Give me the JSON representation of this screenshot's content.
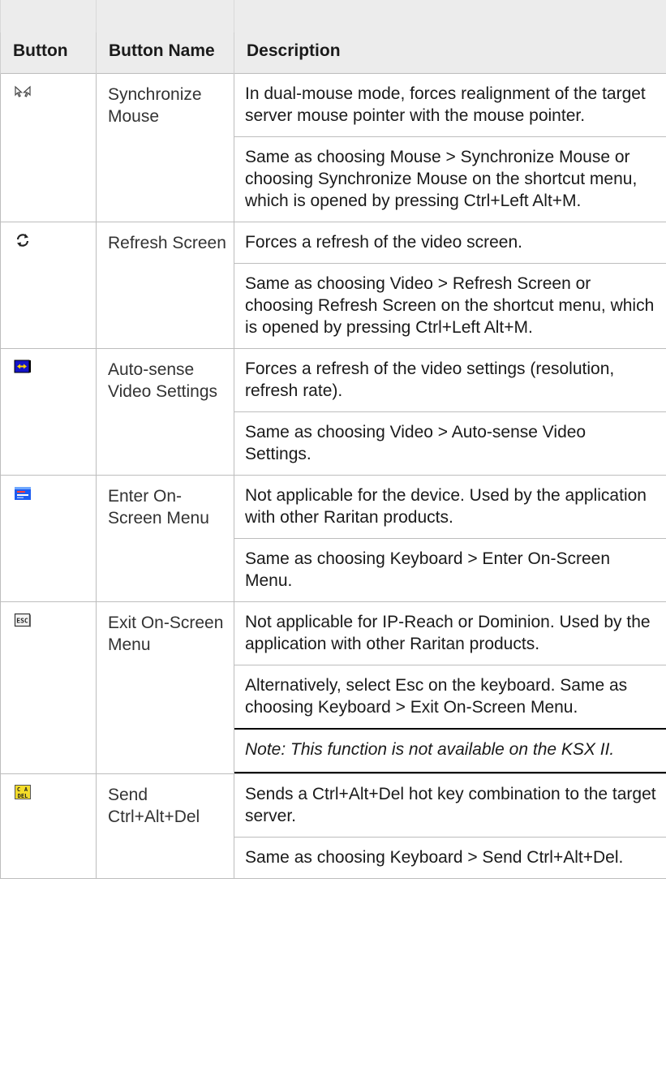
{
  "headers": {
    "button": "Button",
    "button_name": "Button Name",
    "description": "Description"
  },
  "rows": [
    {
      "icon": "synchronize-mouse-icon",
      "name": "Synchronize Mouse",
      "paragraphs": [
        "In dual-mouse mode, forces realignment of the target server mouse pointer with the mouse pointer.",
        "Same as choosing Mouse > Synchronize Mouse or choosing Synchronize Mouse on the shortcut menu, which is opened by pressing Ctrl+Left Alt+M."
      ]
    },
    {
      "icon": "refresh-screen-icon",
      "name": "Refresh Screen",
      "paragraphs": [
        "Forces a refresh of the video screen.",
        "Same as choosing Video > Refresh Screen or choosing Refresh Screen on the shortcut menu, which is opened by pressing Ctrl+Left Alt+M."
      ]
    },
    {
      "icon": "auto-sense-video-icon",
      "name": "Auto-sense Video Settings",
      "paragraphs": [
        "Forces a refresh of the video settings (resolution, refresh rate).",
        "Same as choosing Video > Auto-sense Video Settings."
      ]
    },
    {
      "icon": "enter-osd-menu-icon",
      "name": "Enter On-Screen Menu",
      "paragraphs": [
        "Not applicable for the device. Used by the application with other Raritan products.",
        "Same as choosing Keyboard > Enter On-Screen Menu."
      ]
    },
    {
      "icon": "exit-osd-menu-icon",
      "name": "Exit On-Screen Menu",
      "paragraphs": [
        "Not applicable for IP-Reach or Dominion. Used by the application with other Raritan products.",
        "Alternatively, select Esc on the keyboard. Same as choosing Keyboard > Exit On-Screen Menu."
      ],
      "note": "Note: This function is not available on the KSX II."
    },
    {
      "icon": "ctrl-alt-del-icon",
      "name": "Send Ctrl+Alt+Del",
      "paragraphs": [
        "Sends a Ctrl+Alt+Del hot key combination to the target server.",
        "Same as choosing Keyboard > Send Ctrl+Alt+Del."
      ]
    }
  ]
}
